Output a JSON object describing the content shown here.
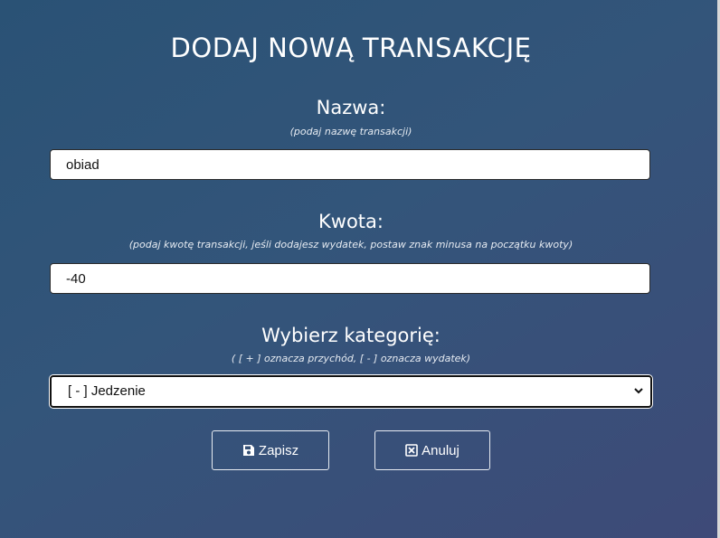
{
  "page": {
    "title": "DODAJ NOWĄ TRANSAKCJĘ"
  },
  "name_field": {
    "label": "Nazwa:",
    "hint": "(podaj nazwę transakcji)",
    "value": "obiad"
  },
  "amount_field": {
    "label": "Kwota:",
    "hint": "(podaj kwotę transakcji, jeśli dodajesz wydatek, postaw znak minusa na początku kwoty)",
    "value": "-40"
  },
  "category_field": {
    "label": "Wybierz kategorię:",
    "hint": "( [ + ] oznacza przychód, [ - ] oznacza wydatek)",
    "selected": "[ - ] Jedzenie"
  },
  "actions": {
    "save_label": "Zapisz",
    "save_icon": "save-icon",
    "cancel_label": "Anuluj",
    "cancel_icon": "close-box-icon"
  },
  "colors": {
    "background_start": "#2a5275",
    "background_end": "#3e4a78",
    "text": "#ffffff"
  }
}
